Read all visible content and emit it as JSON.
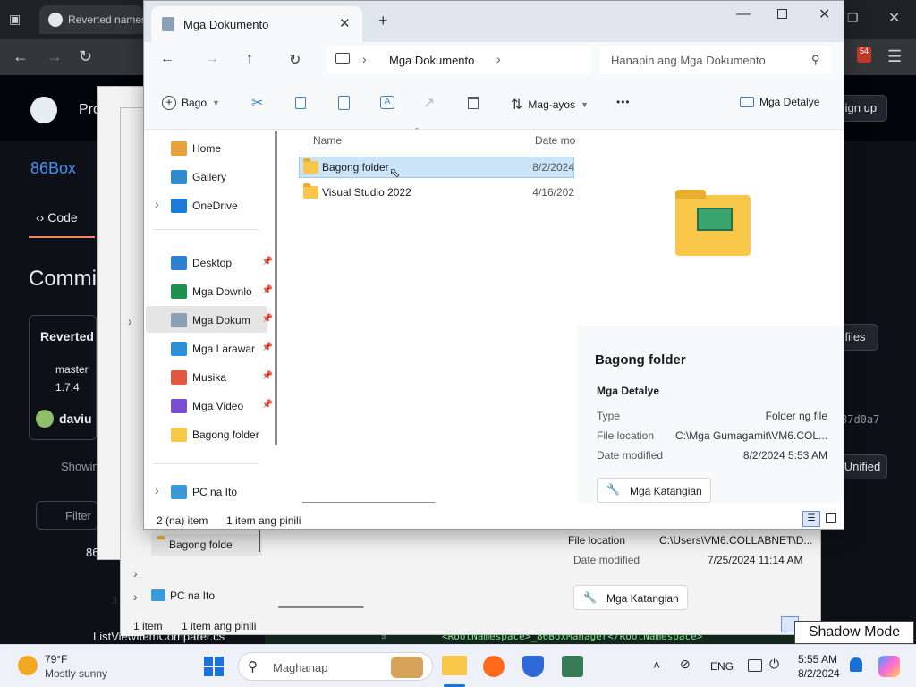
{
  "browser": {
    "tab_title": "Reverted names",
    "gh": {
      "pro": "Pro",
      "sign_up": "Sign up",
      "repo": "86Box",
      "code_tab": "Code",
      "commit_heading": "Commi",
      "commit_title": "Reverted",
      "branch": "master",
      "tag": "1.7.4",
      "author": "daviu",
      "showing": "Showin",
      "filter": "Filter",
      "files_btn": "files",
      "hash": "87d0a7",
      "unified": "Unified",
      "tree_folder": "86",
      "tree_file": "ListViewItemComparer.cs",
      "code_line": "<RootNamespace>_86BoxManager</RootNamespace>",
      "code_guid": "Guid>",
      "line_no": "9"
    }
  },
  "back_window": {
    "pinned_folder": "Bagong folde",
    "pc": "PC na Ito",
    "status_count": "1 item",
    "status_selected": "1 item ang pinili",
    "file_location_label": "File location",
    "file_location_value": "C:\\Users\\VM6.COLLABNET\\D...",
    "date_modified_label": "Date modified",
    "date_modified_value": "7/25/2024 11:14 AM",
    "properties_btn": "Mga Katangian",
    "num_3": "3"
  },
  "explorer": {
    "tab_title": "Mga Dokumento",
    "breadcrumb": "Mga Dokumento",
    "search_placeholder": "Hanapin ang Mga Dokumento",
    "toolbar": {
      "new": "Bago",
      "sort": "Mag-ayos",
      "more": "•••",
      "details": "Mga Detalye"
    },
    "nav": [
      {
        "label": "Home",
        "color": "#e9a23b",
        "pinned": false
      },
      {
        "label": "Gallery",
        "color": "#2f8ad0",
        "pinned": false
      },
      {
        "label": "OneDrive",
        "color": "#1c7ad9",
        "pinned": false
      },
      {
        "label": "Desktop",
        "color": "#2d7fcf",
        "pinned": true
      },
      {
        "label": "Mga Downlo",
        "color": "#1f8f4e",
        "pinned": true
      },
      {
        "label": "Mga Dokum",
        "color": "#8aa0b7",
        "pinned": true
      },
      {
        "label": "Mga Larawar",
        "color": "#2c8fd6",
        "pinned": true
      },
      {
        "label": "Musika",
        "color": "#e2583e",
        "pinned": true
      },
      {
        "label": "Mga Video",
        "color": "#7b4bd1",
        "pinned": true
      },
      {
        "label": "Bagong folder",
        "color": "#f8c74a",
        "pinned": false
      },
      {
        "label": "PC na Ito",
        "color": "#3a99d8",
        "pinned": false
      }
    ],
    "columns": {
      "name": "Name",
      "date": "Date mo"
    },
    "files": [
      {
        "name": "Bagong folder",
        "date": "8/2/2024"
      },
      {
        "name": "Visual Studio 2022",
        "date": "4/16/202"
      }
    ],
    "details": {
      "title": "Bagong folder",
      "section": "Mga Detalye",
      "rows": [
        {
          "label": "Type",
          "value": "Folder ng file"
        },
        {
          "label": "File location",
          "value": "C:\\Mga Gumagamit\\VM6.COL..."
        },
        {
          "label": "Date modified",
          "value": "8/2/2024 5:53 AM"
        }
      ],
      "properties_btn": "Mga Katangian"
    },
    "status": {
      "count": "2 (na) item",
      "selected": "1 item ang pinili"
    }
  },
  "taskbar": {
    "weather_temp": "79°F",
    "weather_desc": "Mostly sunny",
    "search": "Maghanap",
    "lang": "ENG",
    "time": "5:55 AM",
    "date": "8/2/2024",
    "badge_54": "54"
  },
  "shadow_mode": "Shadow Mode"
}
